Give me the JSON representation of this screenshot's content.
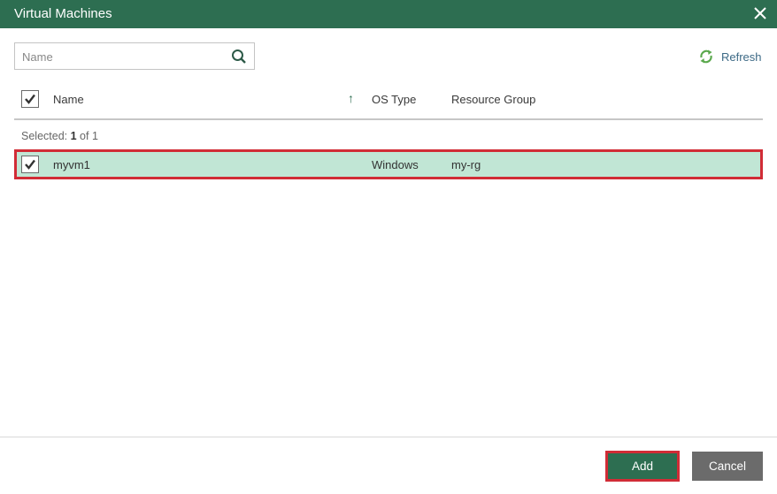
{
  "dialog": {
    "title": "Virtual Machines",
    "close_icon": "close-icon"
  },
  "search": {
    "placeholder": "Name",
    "value": "",
    "icon": "search-icon"
  },
  "refresh": {
    "label": "Refresh",
    "icon": "refresh-icon"
  },
  "table": {
    "columns": [
      {
        "label": "Name",
        "sort": "ascending"
      },
      {
        "label": "OS Type"
      },
      {
        "label": "Resource Group"
      }
    ],
    "header_checked": true,
    "selection": {
      "prefix": "Selected:",
      "count": "1",
      "suffix": "of 1"
    },
    "rows": [
      {
        "checked": true,
        "name": "myvm1",
        "os_type": "Windows",
        "resource_group": "my-rg"
      }
    ]
  },
  "footer": {
    "add_label": "Add",
    "cancel_label": "Cancel"
  },
  "colors": {
    "brand": "#2d6e51",
    "highlight_row": "#c1e6d5",
    "annotation_border": "#d12c36",
    "cancel_button": "#6b6b6b"
  }
}
